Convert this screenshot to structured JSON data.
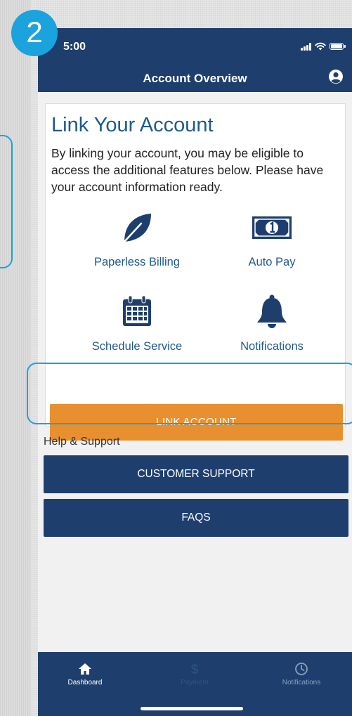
{
  "step_badge": "2",
  "status_bar": {
    "time": "5:00"
  },
  "header": {
    "title": "Account Overview"
  },
  "card": {
    "title": "Link Your Account",
    "description": "By linking your account, you may be eligible to access the additional features below. Please have your account information ready.",
    "features": [
      {
        "label": "Paperless Billing",
        "icon": "leaf-icon"
      },
      {
        "label": "Auto Pay",
        "icon": "dollar-bill-icon"
      },
      {
        "label": "Schedule Service",
        "icon": "calendar-icon"
      },
      {
        "label": "Notifications",
        "icon": "bell-icon"
      }
    ],
    "link_button": "LINK ACCOUNT"
  },
  "help": {
    "label": "Help & Support",
    "customer_support": "CUSTOMER SUPPORT",
    "faqs": "FAQS"
  },
  "tabbar": {
    "items": [
      {
        "label": "Dashboard",
        "icon": "home-icon"
      },
      {
        "label": "Payment",
        "icon": "dollar-icon"
      },
      {
        "label": "Notifications",
        "icon": "clock-icon"
      }
    ]
  },
  "colors": {
    "primary_navy": "#1e3f6e",
    "link_blue": "#1e5a8e",
    "accent_orange": "#e89030",
    "highlight_cyan": "#1aa3dc"
  }
}
